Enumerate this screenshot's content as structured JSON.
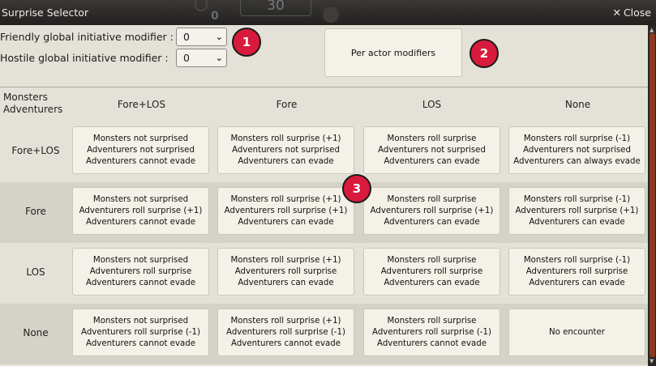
{
  "window": {
    "title": "Surprise Selector",
    "close_label": "Close",
    "background_number": "30",
    "background_zero": "0"
  },
  "modifiers": {
    "friendly_label": "Friendly global initiative modifier :",
    "friendly_value": "0",
    "hostile_label": "Hostile global initiative modifier :",
    "hostile_value": "0"
  },
  "per_actor_button": "Per actor modifiers",
  "badges": [
    "1",
    "2",
    "3"
  ],
  "table": {
    "corner_top": "Monsters",
    "corner_bottom": "Adventurers",
    "columns": [
      "Fore+LOS",
      "Fore",
      "LOS",
      "None"
    ],
    "rows": [
      {
        "label": "Fore+LOS",
        "cells": [
          [
            "Monsters not surprised",
            "Adventurers not surprised",
            "Adventurers cannot evade"
          ],
          [
            "Monsters roll surprise (+1)",
            "Adventurers not surprised",
            "Adventurers can evade"
          ],
          [
            "Monsters roll surprise",
            "Adventurers not surprised",
            "Adventurers can evade"
          ],
          [
            "Monsters roll surprise (-1)",
            "Adventurers not surprised",
            "Adventurers can always evade"
          ]
        ]
      },
      {
        "label": "Fore",
        "cells": [
          [
            "Monsters not surprised",
            "Adventurers roll surprise (+1)",
            "Adventurers cannot evade"
          ],
          [
            "Monsters roll surprise (+1)",
            "Adventurers roll surprise (+1)",
            "Adventurers can evade"
          ],
          [
            "Monsters roll surprise",
            "Adventurers roll surprise (+1)",
            "Adventurers can evade"
          ],
          [
            "Monsters roll surprise (-1)",
            "Adventurers roll surprise (+1)",
            "Adventurers can evade"
          ]
        ]
      },
      {
        "label": "LOS",
        "cells": [
          [
            "Monsters not surprised",
            "Adventurers roll surprise",
            "Adventurers cannot evade"
          ],
          [
            "Monsters roll surprise (+1)",
            "Adventurers roll surprise",
            "Adventurers can evade"
          ],
          [
            "Monsters roll surprise",
            "Adventurers roll surprise",
            "Adventurers can evade"
          ],
          [
            "Monsters roll surprise (-1)",
            "Adventurers roll surprise",
            "Adventurers can evade"
          ]
        ]
      },
      {
        "label": "None",
        "cells": [
          [
            "Monsters not surprised",
            "Adventurers roll surprise (-1)",
            "Adventurers cannot evade"
          ],
          [
            "Monsters roll surprise (+1)",
            "Adventurers roll surprise (-1)",
            "Adventurers cannot evade"
          ],
          [
            "Monsters roll surprise",
            "Adventurers roll surprise (-1)",
            "Adventurers cannot evade"
          ],
          [
            "No encounter"
          ]
        ]
      }
    ]
  },
  "colors": {
    "badge": "#d81b3c",
    "titlebar": "#2b2927",
    "scrollbar_thumb": "#8a3a22"
  }
}
